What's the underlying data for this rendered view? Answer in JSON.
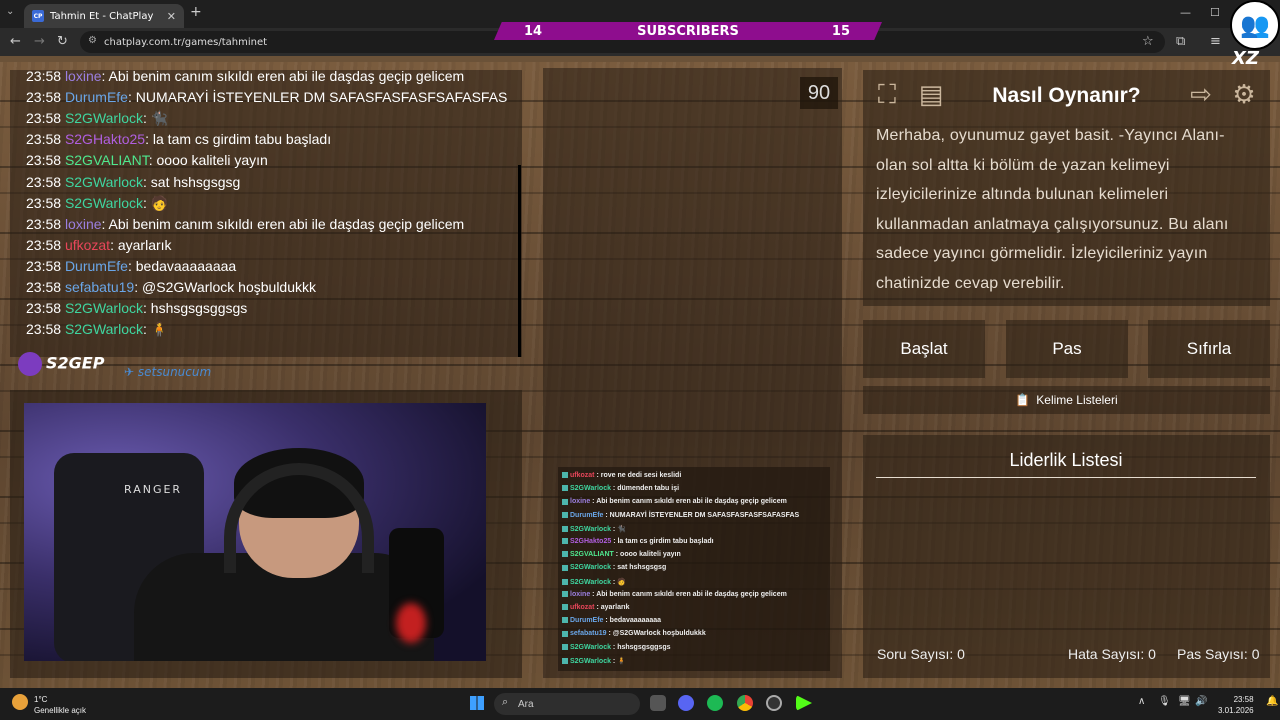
{
  "browser": {
    "tab_title": "Tahmin Et - ChatPlay",
    "favicon_text": "CP",
    "url": "chatplay.com.tr/games/tahminet"
  },
  "subscribers": {
    "left": "14",
    "label": "SUBSCRIBERS",
    "right": "15"
  },
  "chat": [
    {
      "time": "23:58",
      "user": "loxine",
      "color": "#9b7fe0",
      "msg": "Abi benim canım sıkıldı eren abi ile daşdaş geçip gelicem"
    },
    {
      "time": "23:58",
      "user": "DurumEfe",
      "color": "#6aa6e8",
      "msg": "NUMARAYİ İSTEYENLER DM SAFASFASFASFSAFASFAS"
    },
    {
      "time": "23:58",
      "user": "S2GWarlock",
      "color": "#3fd6a0",
      "msg": "🐈‍⬛"
    },
    {
      "time": "23:58",
      "user": "S2GHakto25",
      "color": "#b05fe0",
      "msg": "la tam cs girdim tabu başladı"
    },
    {
      "time": "23:58",
      "user": "S2GVALIANT",
      "color": "#4fe88f",
      "msg": "oooo kaliteli yayın"
    },
    {
      "time": "23:58",
      "user": "S2GWarlock",
      "color": "#3fd6a0",
      "msg": "sat hshsgsgsg"
    },
    {
      "time": "23:58",
      "user": "S2GWarlock",
      "color": "#3fd6a0",
      "msg": "🧑"
    },
    {
      "time": "23:58",
      "user": "loxine",
      "color": "#9b7fe0",
      "msg": "Abi benim canım sıkıldı eren abi ile daşdaş geçip gelicem"
    },
    {
      "time": "23:58",
      "user": "ufkozat",
      "color": "#e8465a",
      "msg": "ayarlarık"
    },
    {
      "time": "23:58",
      "user": "DurumEfe",
      "color": "#6aa6e8",
      "msg": "bedavaaaaaaaa"
    },
    {
      "time": "23:58",
      "user": "sefabatu19",
      "color": "#6aa6e8",
      "msg": "@S2GWarlock hoşbuldukkk"
    },
    {
      "time": "23:58",
      "user": "S2GWarlock",
      "color": "#3fd6a0",
      "msg": "hshsgsgsggsgs"
    },
    {
      "time": "23:58",
      "user": "S2GWarlock",
      "color": "#3fd6a0",
      "msg": "🧍"
    }
  ],
  "sponsors": {
    "first": "S2GEP",
    "second": "setsunucum"
  },
  "webcam": {
    "shirt_text": "RANGER"
  },
  "timer": "90",
  "mini_chat": [
    {
      "user": "ufkozat",
      "color": "#e8465a",
      "msg": "rove ne dedi sesi keslidi"
    },
    {
      "user": "S2GWarlock",
      "color": "#3fd6a0",
      "msg": "dümenden tabu işi"
    },
    {
      "user": "loxine",
      "color": "#9b7fe0",
      "msg": "Abi benim canım sıkıldı eren abi ile daşdaş geçip gelicem"
    },
    {
      "user": "DurumEfe",
      "color": "#6aa6e8",
      "msg": "NUMARAYİ İSTEYENLER DM SAFASFASFASFSAFASFAS"
    },
    {
      "user": "S2GWarlock",
      "color": "#3fd6a0",
      "msg": "🐈‍⬛"
    },
    {
      "user": "S2GHakto25",
      "color": "#b05fe0",
      "msg": "la tam cs girdim tabu başladı"
    },
    {
      "user": "S2GVALIANT",
      "color": "#4fe88f",
      "msg": "oooo kaliteli yayın"
    },
    {
      "user": "S2GWarlock",
      "color": "#3fd6a0",
      "msg": "sat hshsgsgsg"
    },
    {
      "user": "S2GWarlock",
      "color": "#3fd6a0",
      "msg": "🧑"
    },
    {
      "user": "loxine",
      "color": "#9b7fe0",
      "msg": "Abi benim canım sıkıldı eren abi ile daşdaş geçip gelicem"
    },
    {
      "user": "ufkozat",
      "color": "#e8465a",
      "msg": "ayarlarık"
    },
    {
      "user": "DurumEfe",
      "color": "#6aa6e8",
      "msg": "bedavaaaaaaaa"
    },
    {
      "user": "sefabatu19",
      "color": "#6aa6e8",
      "msg": "@S2GWarlock hoşbuldukkk"
    },
    {
      "user": "S2GWarlock",
      "color": "#3fd6a0",
      "msg": "hshsgsgsggsgs"
    },
    {
      "user": "S2GWarlock",
      "color": "#3fd6a0",
      "msg": "🧍"
    }
  ],
  "howto": {
    "title": "Nasıl Oynanır?",
    "body": "Merhaba, oyunumuz gayet basit. -Yayıncı Alanı- olan sol altta ki bölüm de yazan kelimeyi izleyicilerinize altında bulunan kelimeleri kullanmadan anlatmaya çalışıyorsunuz. Bu alanı sadece yayıncı görmelidir. İzleyicileriniz yayın chatinizde cevap verebilir."
  },
  "buttons": {
    "start": "Başlat",
    "pass": "Pas",
    "reset": "Sıfırla",
    "word_lists": "Kelime Listeleri"
  },
  "leaderboard": {
    "title": "Liderlik Listesi",
    "questions_label": "Soru Sayısı:",
    "questions": "0",
    "errors_label": "Hata Sayısı:",
    "errors": "0",
    "passes_label": "Pas Sayısı:",
    "passes": "0"
  },
  "taskbar": {
    "temp": "1°C",
    "weather": "Genellikle açık",
    "search_placeholder": "Ara",
    "time": "23:58",
    "date": "3.01.2026"
  }
}
